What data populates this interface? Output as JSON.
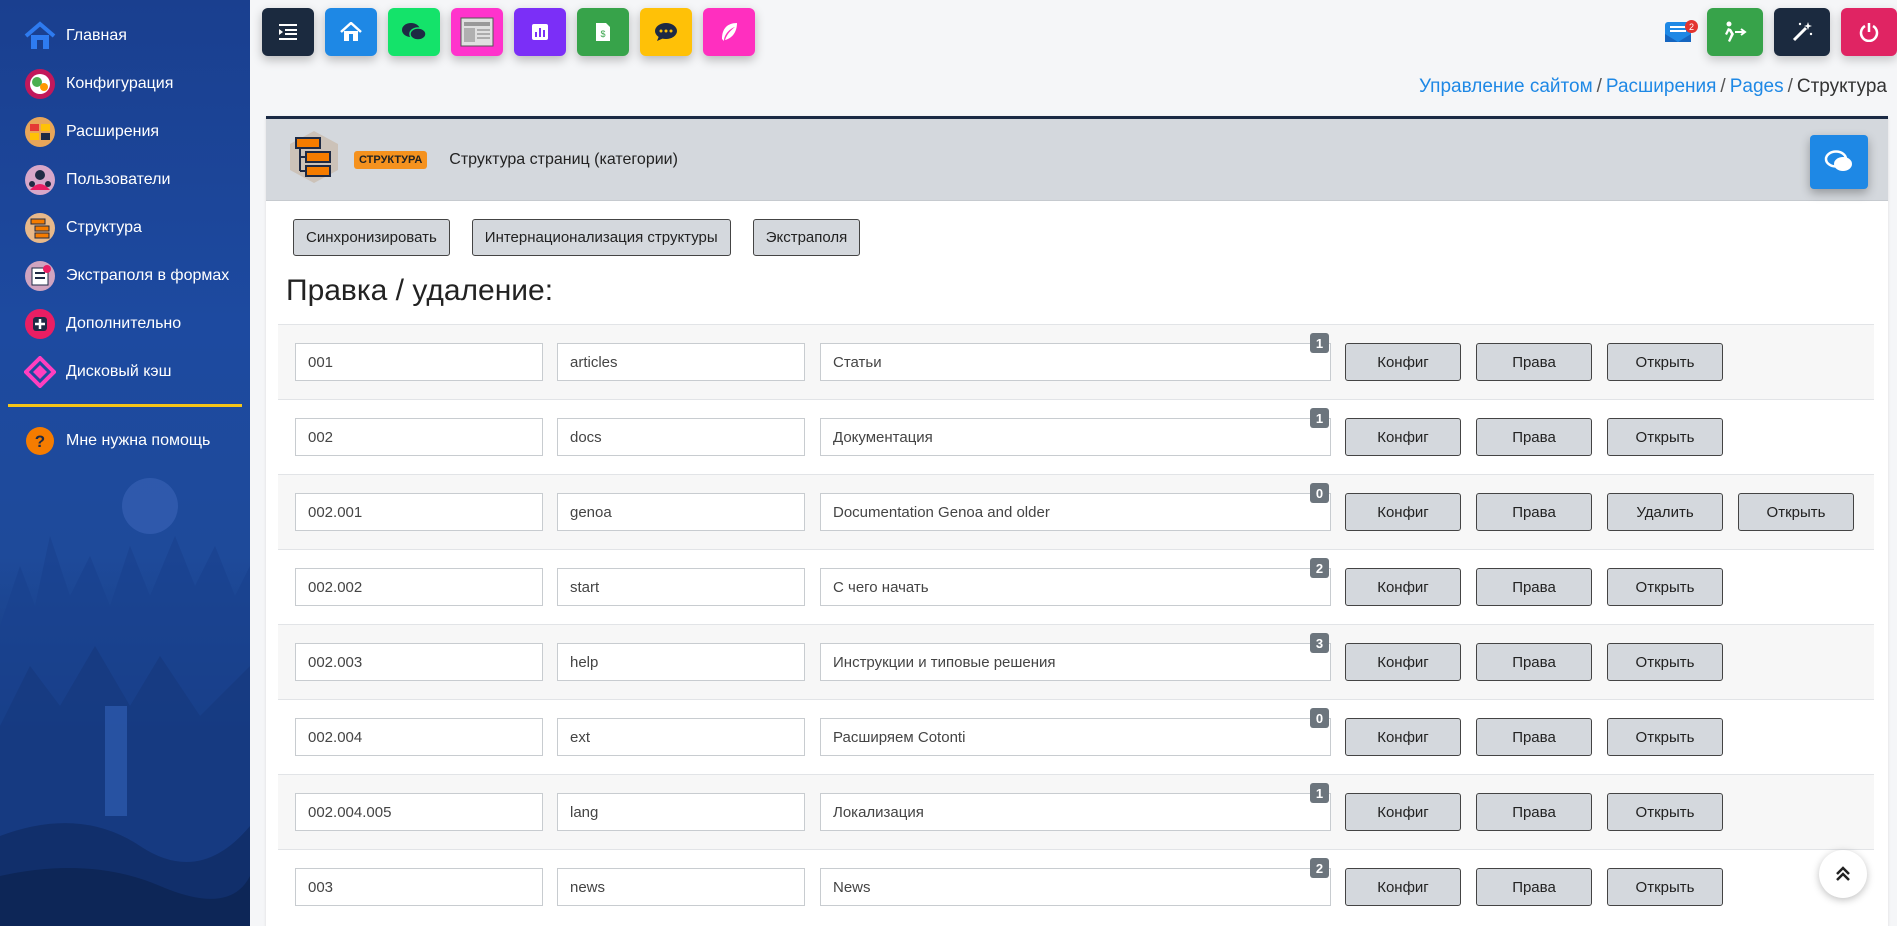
{
  "sidebar": {
    "items": [
      {
        "label": "Главная",
        "icon": "home-icon"
      },
      {
        "label": "Конфигурация",
        "icon": "config-icon"
      },
      {
        "label": "Расширения",
        "icon": "extensions-icon"
      },
      {
        "label": "Пользователи",
        "icon": "users-icon"
      },
      {
        "label": "Структура",
        "icon": "structure-icon"
      },
      {
        "label": "Экстраполя в формах",
        "icon": "extrafields-icon"
      },
      {
        "label": "Дополнительно",
        "icon": "plus-icon"
      },
      {
        "label": "Дисковый кэш",
        "icon": "cache-icon"
      }
    ],
    "help": {
      "label": "Мне нужна помощь",
      "icon": "help-icon"
    }
  },
  "toolbar": {
    "buttons": [
      {
        "icon": "menu-collapse-icon",
        "color": "#1b2a3f"
      },
      {
        "icon": "home-icon",
        "color": "#1e88e5"
      },
      {
        "icon": "chat-icon",
        "color": "#14e36a"
      },
      {
        "icon": "pages-icon",
        "color": "#ff33cc"
      },
      {
        "icon": "stats-icon",
        "color": "#7b2ff7"
      },
      {
        "icon": "document-icon",
        "color": "#37a34a"
      },
      {
        "icon": "comment-icon",
        "color": "#ffc107"
      },
      {
        "icon": "feather-icon",
        "color": "#ff2fbf"
      }
    ]
  },
  "topright": {
    "mail_badge": "2",
    "buttons": [
      {
        "icon": "exit-icon",
        "color": "#37a34a"
      },
      {
        "icon": "magic-wand-icon",
        "color": "#1b2a3f"
      },
      {
        "icon": "power-icon",
        "color": "#e02463"
      }
    ]
  },
  "breadcrumb": {
    "items": [
      "Управление сайтом",
      "Расширения",
      "Pages"
    ],
    "current": "Структура"
  },
  "card": {
    "tag": "СТРУКТУРА",
    "title": "Структура страниц (категории)",
    "actions": [
      "Синхронизировать",
      "Интернационализация структуры",
      "Экстраполя"
    ],
    "section_title": "Правка / удаление:"
  },
  "button_labels": {
    "config": "Конфиг",
    "rights": "Права",
    "delete": "Удалить",
    "open": "Открыть"
  },
  "rows": [
    {
      "code": "001",
      "alias": "articles",
      "title": "Статьи",
      "count": "1",
      "deletable": false
    },
    {
      "code": "002",
      "alias": "docs",
      "title": "Документация",
      "count": "1",
      "deletable": false
    },
    {
      "code": "002.001",
      "alias": "genoa",
      "title": "Documentation Genoa and older",
      "count": "0",
      "deletable": true
    },
    {
      "code": "002.002",
      "alias": "start",
      "title": "С чего начать",
      "count": "2",
      "deletable": false
    },
    {
      "code": "002.003",
      "alias": "help",
      "title": "Инструкции и типовые решения",
      "count": "3",
      "deletable": false
    },
    {
      "code": "002.004",
      "alias": "ext",
      "title": "Расширяем Cotonti",
      "count": "0",
      "deletable": false
    },
    {
      "code": "002.004.005",
      "alias": "lang",
      "title": "Локализация",
      "count": "1",
      "deletable": false
    },
    {
      "code": "003",
      "alias": "news",
      "title": "News",
      "count": "2",
      "deletable": false
    }
  ]
}
